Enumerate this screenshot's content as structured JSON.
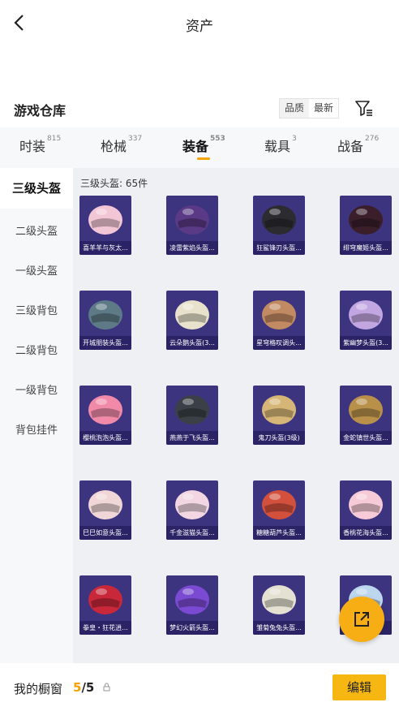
{
  "header": {
    "title": "资产"
  },
  "section": {
    "title": "游戏仓库",
    "sort_options": [
      "品质",
      "最新"
    ],
    "active_sort": 1
  },
  "tabs": [
    {
      "label": "时装",
      "count": "815"
    },
    {
      "label": "枪械",
      "count": "337"
    },
    {
      "label": "装备",
      "count": "553"
    },
    {
      "label": "载具",
      "count": "3"
    },
    {
      "label": "战备",
      "count": "276"
    }
  ],
  "active_tab": 2,
  "sidebar": {
    "items": [
      {
        "label": "三级头盔"
      },
      {
        "label": "二级头盔"
      },
      {
        "label": "一级头盔"
      },
      {
        "label": "三级背包"
      },
      {
        "label": "二级背包"
      },
      {
        "label": "一级背包"
      },
      {
        "label": "背包挂件"
      }
    ]
  },
  "content": {
    "count_label": "三级头盔: 65件",
    "items": [
      {
        "name": "喜羊羊与灰太...",
        "color": "#f3c6d6",
        "icon": "helmet-icon"
      },
      {
        "name": "凌雷紫焰头盔...",
        "color": "#5a3a86",
        "icon": "helmet-icon"
      },
      {
        "name": "狂鲨锋刃头盔...",
        "color": "#2c2c30",
        "icon": "helmet-icon"
      },
      {
        "name": "绯穹魔姬头盔...",
        "color": "#3a1e2a",
        "icon": "helmet-icon"
      },
      {
        "name": "开城朋装头盔...",
        "color": "#5d7a86",
        "icon": "helmet-icon"
      },
      {
        "name": "云朵鹅头盔(3...",
        "color": "#e8e2cc",
        "icon": "helmet-icon"
      },
      {
        "name": "星穹格叹调头...",
        "color": "#c28a62",
        "icon": "helmet-icon"
      },
      {
        "name": "紫幽梦头盔(3...",
        "color": "#c2a6e2",
        "icon": "helmet-icon"
      },
      {
        "name": "樱桃泡泡头盔...",
        "color": "#f08aa8",
        "icon": "helmet-icon"
      },
      {
        "name": "燕燕于飞头盔...",
        "color": "#3a4046",
        "icon": "helmet-icon"
      },
      {
        "name": "鬼刀头盔(3级)",
        "color": "#d6b676",
        "icon": "helmet-icon"
      },
      {
        "name": "金蛇镇世头盔...",
        "color": "#b8904a",
        "icon": "helmet-icon"
      },
      {
        "name": "巳巳如意头盔...",
        "color": "#f0d6d6",
        "icon": "helmet-icon"
      },
      {
        "name": "千金滋猫头盔...",
        "color": "#f2d6e2",
        "icon": "helmet-icon"
      },
      {
        "name": "糖糖葫芦头盔...",
        "color": "#d2503c",
        "icon": "helmet-icon"
      },
      {
        "name": "香桃花海头盔...",
        "color": "#f6cad6",
        "icon": "helmet-icon"
      },
      {
        "name": "拳皇・狂花逍...",
        "color": "#c8283a",
        "icon": "helmet-icon"
      },
      {
        "name": "梦幻火箭头盔...",
        "color": "#7a4ad2",
        "icon": "helmet-icon"
      },
      {
        "name": "雏菊兔兔头盔...",
        "color": "#e4e0d2",
        "icon": "helmet-icon"
      },
      {
        "name": "",
        "color": "#bcd6ee",
        "icon": "helmet-icon"
      }
    ]
  },
  "bottom": {
    "showcase_label": "我的橱窗",
    "current": "5",
    "total": "/5",
    "edit_label": "编辑"
  },
  "colors": {
    "accent": "#f5a300",
    "card_bg": "#3d3480",
    "card_label_bg": "#2a2466"
  }
}
